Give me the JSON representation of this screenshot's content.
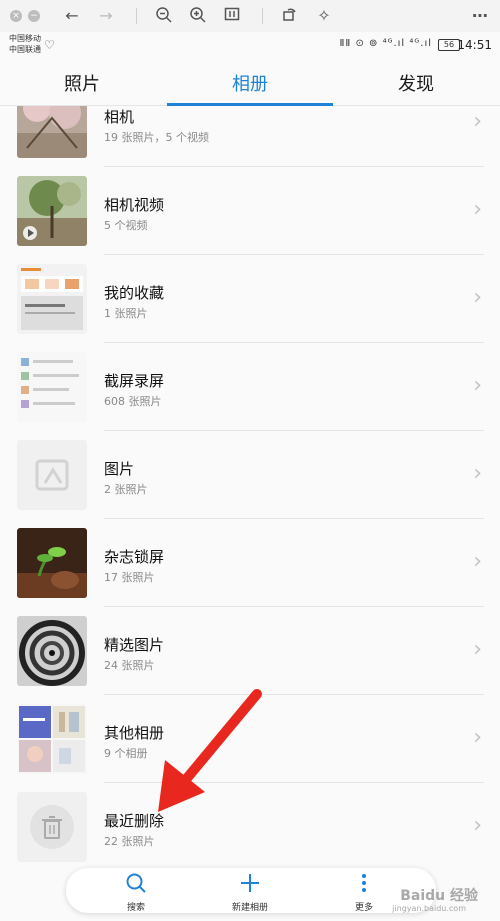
{
  "viewer": {
    "icons": [
      "close-circle-icon",
      "minimize-circle-icon",
      "back-arrow-icon",
      "forward-arrow-icon",
      "zoom-out-icon",
      "zoom-in-icon",
      "fit-icon",
      "rotate-icon",
      "magic-wand-icon",
      "more-horizontal-icon"
    ]
  },
  "status": {
    "carrier1": "中国移动",
    "carrier2": "中国联通",
    "network": "ⅡⅡ ⊙ ⊚ ⁴ᴳ.ıl ⁴ᴳ.ıl",
    "battery": "56",
    "time": "14:51"
  },
  "tabs": [
    {
      "label": "照片"
    },
    {
      "label": "相册"
    },
    {
      "label": "发现"
    }
  ],
  "albums": [
    {
      "title": "相机",
      "count": "19 张照片，5 个视频",
      "thumb": "cherry-blossom-photo"
    },
    {
      "title": "相机视频",
      "count": "5 个视频",
      "thumb": "tree-video-thumbnail"
    },
    {
      "title": "我的收藏",
      "count": "1 张照片",
      "thumb": "app-screenshot"
    },
    {
      "title": "截屏录屏",
      "count": "608 张照片",
      "thumb": "chat-screenshot"
    },
    {
      "title": "图片",
      "count": "2 张照片",
      "thumb": "placeholder-image-icon"
    },
    {
      "title": "杂志锁屏",
      "count": "17 张照片",
      "thumb": "green-sprout-photo"
    },
    {
      "title": "精选图片",
      "count": "24 张照片",
      "thumb": "spiral-staircase-photo"
    },
    {
      "title": "其他相册",
      "count": "9 个相册",
      "thumb": "album-collage"
    },
    {
      "title": "最近删除",
      "count": "22 张照片",
      "thumb": "trash-icon"
    }
  ],
  "bottom": {
    "search": "搜索",
    "new_album": "新建相册",
    "more": "更多"
  },
  "watermark": {
    "brand": "Baidu 经验",
    "url": "jingyan.baidu.com"
  },
  "colors": {
    "accent": "#1f82d6",
    "arrow": "#e8271e"
  }
}
